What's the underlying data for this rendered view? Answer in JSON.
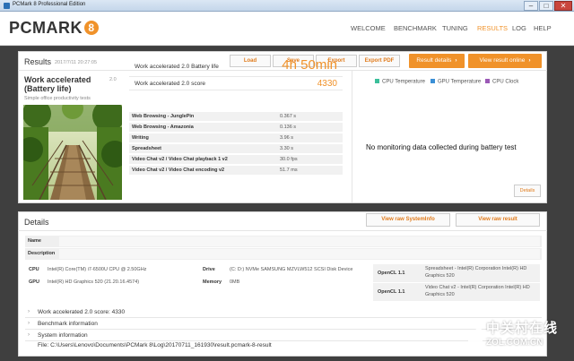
{
  "window": {
    "title": "PCMark 8 Professional Edition"
  },
  "app": {
    "logo_text": "PCMARK",
    "logo_number": "8",
    "nav": [
      "WELCOME",
      "BENCHMARK",
      "TUNING",
      "RESULTS",
      "LOG",
      "HELP"
    ],
    "active_nav": "RESULTS"
  },
  "results": {
    "title": "Results",
    "timestamp": "2017/7/11 20:27:05",
    "buttons": {
      "load": "Load",
      "save": "Save",
      "export": "Export",
      "export_pdf": "Export PDF",
      "result_details": "Result details",
      "view_online": "View result online"
    },
    "benchmark": {
      "name": "Work accelerated (Battery life)",
      "version": "2.0",
      "subtitle": "Simple office productivity tests"
    },
    "main_rows": [
      {
        "label": "Work accelerated 2.0 Battery life",
        "value": "4h 50min"
      },
      {
        "label": "Work accelerated 2.0 score",
        "value": "4330"
      }
    ],
    "sub_rows": [
      {
        "label": "Web Browsing - JunglePin",
        "value": "0.367 s"
      },
      {
        "label": "Web Browsing - Amazonia",
        "value": "0.136 s"
      },
      {
        "label": "Writing",
        "value": "3.96 s"
      },
      {
        "label": "Spreadsheet",
        "value": "3.30 s"
      },
      {
        "label": "Video Chat v2 / Video Chat playback 1 v2",
        "value": "30.0 fps"
      },
      {
        "label": "Video Chat v2 / Video Chat encoding v2",
        "value": "51.7 ms"
      }
    ],
    "legend": [
      {
        "label": "CPU Temperature",
        "color": "#3bbf9a"
      },
      {
        "label": "GPU Temperature",
        "color": "#3a8fd6"
      },
      {
        "label": "CPU Clock",
        "color": "#9b59b6"
      }
    ],
    "no_data": "No monitoring data collected during battery test",
    "details_button": "Details"
  },
  "details": {
    "title": "Details",
    "view_systeminfo": "View raw SystemInfo",
    "view_result": "View raw result",
    "name_label": "Name",
    "description_label": "Description",
    "cpu_label": "CPU",
    "cpu_value": "Intel(R) Core(TM) i7-6500U CPU @ 2.50GHz",
    "gpu_label": "GPU",
    "gpu_value": "Intel(R) HD Graphics 520 (21.20.16.4574)",
    "drive_label": "Drive",
    "drive_value": "(C: D:) NVMe SAMSUNG MZVLW512 SCSI Disk Device",
    "memory_label": "Memory",
    "memory_value": "0MB",
    "opencl": [
      {
        "label": "OpenCL 1.1",
        "value": "Spreadsheet - Intel(R) Corporation Intel(R) HD Graphics 520"
      },
      {
        "label": "OpenCL 1.1",
        "value": "Video Chat v2 - Intel(R) Corporation Intel(R) HD Graphics 520"
      }
    ],
    "expanders": [
      "Work accelerated 2.0 score: 4330",
      "Benchmark information",
      "System information"
    ],
    "file_path": "File: C:\\Users\\Lenovo\\Documents\\PCMark 8\\Log\\20170711_161930\\result.pcmark-8-result"
  },
  "watermark": {
    "cn": "中关村在线",
    "url": "ZOL.COM.CN"
  }
}
